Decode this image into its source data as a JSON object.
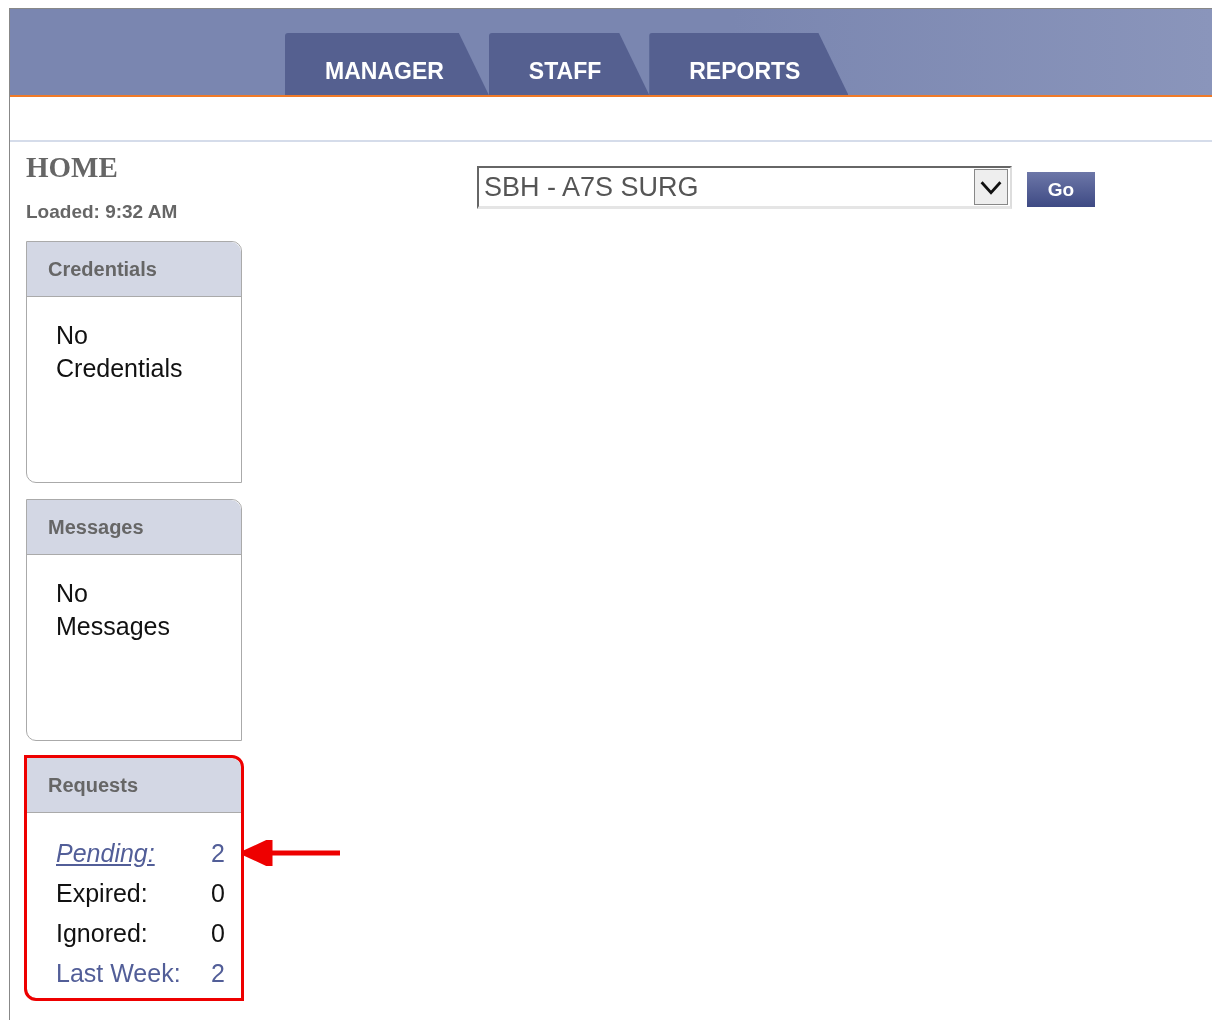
{
  "tabs": [
    {
      "label": "MANAGER"
    },
    {
      "label": "STAFF"
    },
    {
      "label": "REPORTS"
    }
  ],
  "page": {
    "title": "HOME",
    "loaded": "Loaded: 9:32 AM"
  },
  "unit_select": {
    "value": "SBH - A7S SURG"
  },
  "go_button": "Go",
  "panels": [
    {
      "title": "Credentials",
      "kind": "message",
      "annotated": false,
      "message": "No Credentials"
    },
    {
      "title": "Messages",
      "kind": "message",
      "annotated": false,
      "message": "No Messages"
    },
    {
      "title": "Requests",
      "kind": "counts",
      "annotated": true,
      "rows": [
        {
          "kind": "link",
          "label": "Pending:",
          "count": "2"
        },
        {
          "kind": "plain",
          "label": "Expired:",
          "count": "0"
        },
        {
          "kind": "plain",
          "label": "Ignored:",
          "count": "0"
        },
        {
          "kind": "accent",
          "label": "Last Week:",
          "count": "2"
        }
      ]
    }
  ]
}
